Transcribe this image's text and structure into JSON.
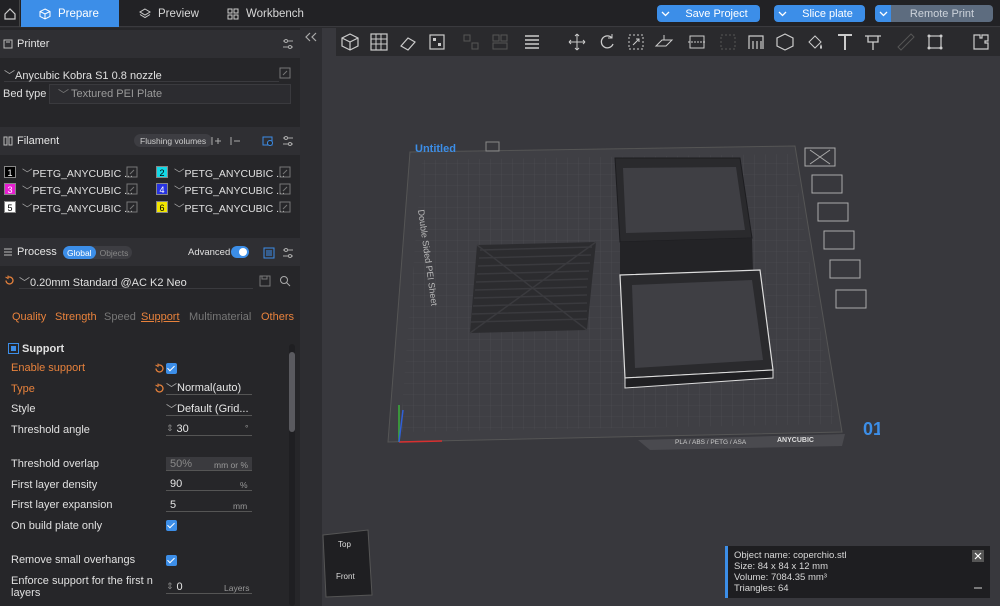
{
  "top_tabs": [
    {
      "label": "Prepare",
      "active": true
    },
    {
      "label": "Preview",
      "active": false
    },
    {
      "label": "Workbench",
      "active": false
    }
  ],
  "top_actions": {
    "save_project": "Save Project",
    "slice_plate": "Slice plate",
    "remote_print": "Remote Print"
  },
  "printer": {
    "section_title": "Printer",
    "name": "Anycubic Kobra S1 0.8 nozzle",
    "bed_type_label": "Bed type",
    "bed_type_value": "Textured PEI Plate"
  },
  "filament": {
    "section_title": "Filament",
    "flushing_label": "Flushing volumes",
    "slots": [
      {
        "num": "1",
        "name": "PETG_ANYCUBIC ...",
        "color": "#000000",
        "text_color": "#ffffff"
      },
      {
        "num": "2",
        "name": "PETG_ANYCUBIC ...",
        "color": "#12d8e6",
        "text_color": "#000000"
      },
      {
        "num": "3",
        "name": "PETG_ANYCUBIC ...",
        "color": "#e81fd2",
        "text_color": "#ffffff"
      },
      {
        "num": "4",
        "name": "PETG_ANYCUBIC ...",
        "color": "#2733e0",
        "text_color": "#ffffff"
      },
      {
        "num": "5",
        "name": "PETG_ANYCUBIC ...",
        "color": "#ffffff",
        "text_color": "#000000"
      },
      {
        "num": "6",
        "name": "PETG_ANYCUBIC ...",
        "color": "#f2e600",
        "text_color": "#000000"
      }
    ]
  },
  "process": {
    "section_title": "Process",
    "toggle_global": "Global",
    "toggle_objects": "Objects",
    "advanced_label": "Advanced",
    "profile": "0.20mm Standard @AC K2 Neo",
    "subtabs": [
      "Quality",
      "Strength",
      "Speed",
      "Support",
      "Multimaterial",
      "Others"
    ],
    "active_subtab": "Support"
  },
  "support": {
    "group_title": "Support",
    "enable_support": "Enable support",
    "type_label": "Type",
    "type_value": "Normal(auto)",
    "style_label": "Style",
    "style_value": "Default (Grid...",
    "threshold_angle_label": "Threshold angle",
    "threshold_angle_value": "30",
    "threshold_angle_unit": "°",
    "threshold_overlap_label": "Threshold overlap",
    "threshold_overlap_value": "50%",
    "threshold_overlap_unit": "mm or %",
    "first_layer_density_label": "First layer density",
    "first_layer_density_value": "90",
    "first_layer_density_unit": "%",
    "first_layer_expansion_label": "First layer expansion",
    "first_layer_expansion_value": "5",
    "first_layer_expansion_unit": "mm",
    "on_build_plate_label": "On build plate only",
    "remove_small_overhangs_label": "Remove small overhangs",
    "enforce_first_n_label_1": "Enforce support for the first n",
    "enforce_first_n_label_2": "layers",
    "enforce_first_n_value": "0",
    "enforce_first_n_unit": "Layers"
  },
  "plate": {
    "title": "Untitled",
    "side_text": "Double Sided PEI Sheet",
    "materials_strip": "PLA / ABS / PETG / ASA",
    "brand": "ANYCUBIC",
    "plate_number": "01"
  },
  "view_cube": {
    "top": "Top",
    "front": "Front"
  },
  "object_info": {
    "name": "Object name: coperchio.stl",
    "size": "Size: 84 x 84 x 12 mm",
    "volume": "Volume: 7084.35 mm³",
    "triangles": "Triangles: 64"
  },
  "colors": {
    "accent": "#3c8ee8",
    "orange": "#e8823c"
  }
}
